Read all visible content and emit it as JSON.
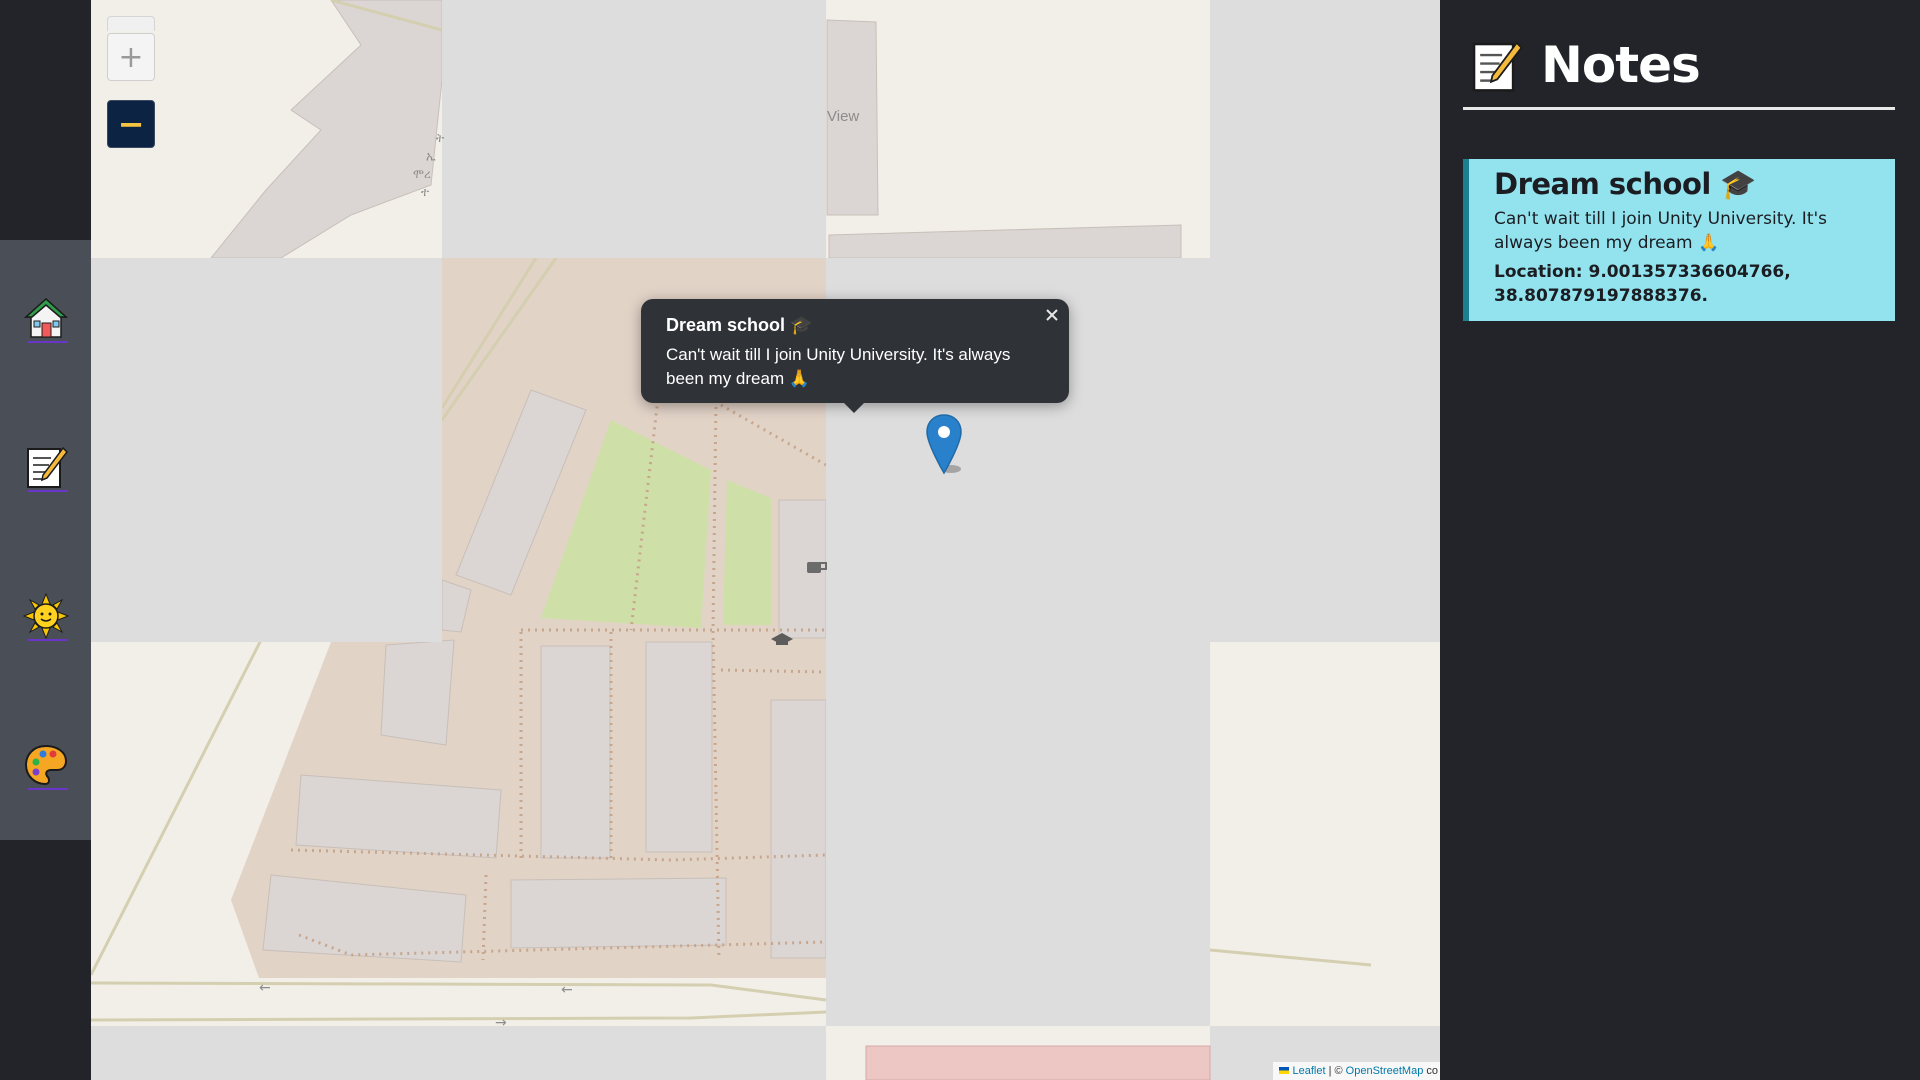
{
  "sidebar": {
    "items": [
      {
        "name": "home",
        "icon": "house-icon"
      },
      {
        "name": "notes",
        "icon": "memo-icon"
      },
      {
        "name": "weather",
        "icon": "sun-icon"
      },
      {
        "name": "theme",
        "icon": "palette-icon"
      }
    ]
  },
  "map": {
    "zoom_in_label": "+",
    "zoom_out_label": "−",
    "place_label": "View",
    "popup": {
      "title": "Dream school 🎓",
      "body": "Can't wait till I join Unity University. It's always been my dream 🙏",
      "close_label": "×"
    },
    "attribution": {
      "leaflet": "Leaflet",
      "separator": " | © ",
      "osm": "OpenStreetMap",
      "suffix": " co"
    }
  },
  "notes_panel": {
    "title": "Notes",
    "icon": "memo-icon",
    "notes": [
      {
        "title": "Dream school 🎓",
        "body": "Can't wait till I join Unity University. It's always been my dream 🙏",
        "location": "Location: 9.001357336604766, 38.807879197888376."
      }
    ]
  },
  "colors": {
    "background": "#222429",
    "sidebar_nav": "#4a4f57",
    "note_card": "#93e3ee",
    "note_card_border": "#1a7f8e",
    "popup": "#2f3237",
    "marker": "#2a81cb",
    "zoom_out_bg": "#0c2344",
    "zoom_out_fg": "#f5c542"
  }
}
